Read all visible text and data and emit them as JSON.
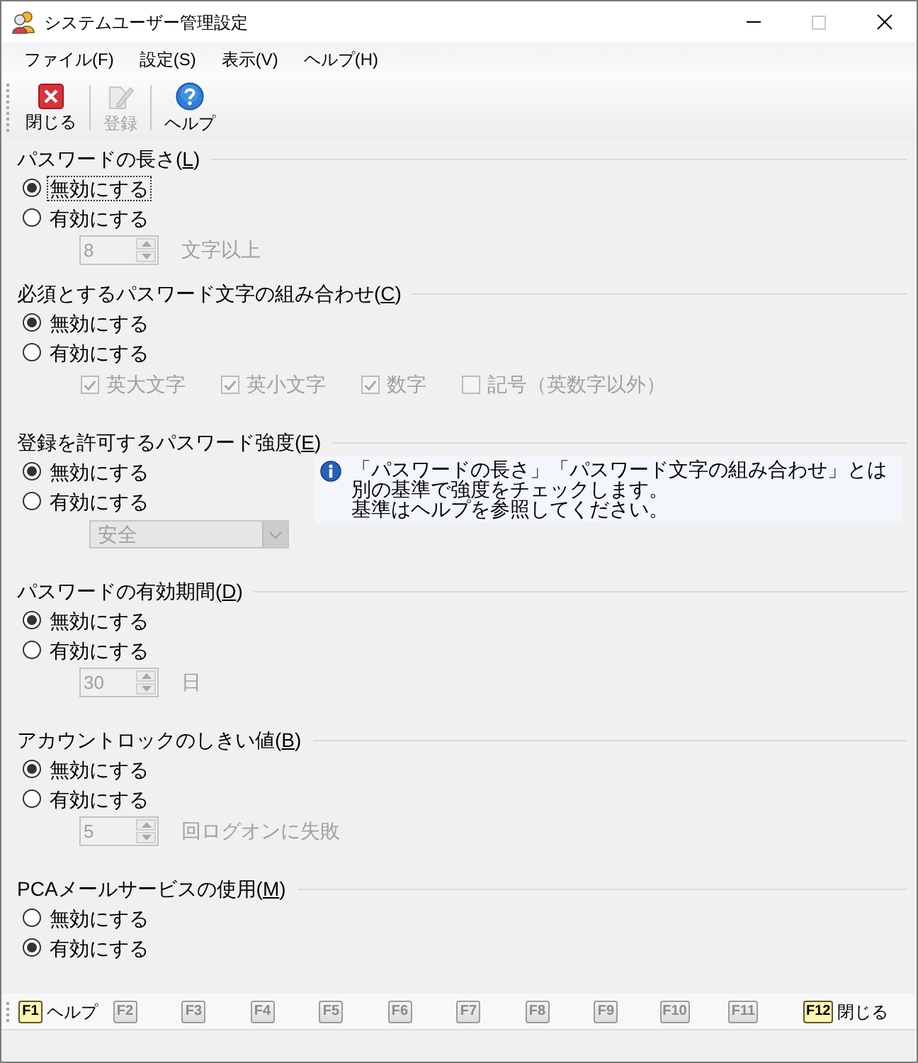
{
  "window": {
    "title": "システムユーザー管理設定"
  },
  "menu": [
    "ファイル(F)",
    "設定(S)",
    "表示(V)",
    "ヘルプ(H)"
  ],
  "toolbar": [
    {
      "kind": "close",
      "label": "閉じる",
      "disabled": false
    },
    {
      "kind": "register",
      "label": "登録",
      "disabled": true
    },
    {
      "kind": "help",
      "label": "ヘルプ",
      "disabled": false
    }
  ],
  "sections": [
    {
      "title": {
        "text": "パスワードの長さ(",
        "key": "L",
        "end": ")"
      },
      "options": [
        {
          "label": "無効にする",
          "selected": true,
          "focused": true
        },
        {
          "label": "有効にする",
          "selected": false,
          "focused": false
        }
      ],
      "detail": {
        "kind": "spinner",
        "value": "8",
        "unit": "文字以上",
        "disabled": true
      }
    },
    {
      "title": {
        "text": "必須とするパスワード文字の組み合わせ(",
        "key": "C",
        "end": ")"
      },
      "options": [
        {
          "label": "無効にする",
          "selected": true,
          "focused": false
        },
        {
          "label": "有効にする",
          "selected": false,
          "focused": false
        }
      ],
      "detail": {
        "kind": "checkboxes",
        "items": [
          {
            "label": "英大文字",
            "checked": true,
            "disabled": true
          },
          {
            "label": "英小文字",
            "checked": true,
            "disabled": true
          },
          {
            "label": "数字",
            "checked": true,
            "disabled": true
          },
          {
            "label": "記号（英数字以外）",
            "checked": false,
            "disabled": true
          }
        ]
      }
    },
    {
      "title": {
        "text": "登録を許可するパスワード強度(",
        "key": "E",
        "end": ")"
      },
      "options": [
        {
          "label": "無効にする",
          "selected": true,
          "focused": false
        },
        {
          "label": "有効にする",
          "selected": false,
          "focused": false
        }
      ],
      "detail": {
        "kind": "dropdown",
        "value": "安全",
        "disabled": true
      },
      "note": {
        "paragraphs": [
          "「パスワードの長さ」「パスワード文字の組み合わせ」とは別の基準で強度をチェックします。",
          "基準はヘルプを参照してください。"
        ]
      }
    },
    {
      "title": {
        "text": "パスワードの有効期間(",
        "key": "D",
        "end": ")"
      },
      "options": [
        {
          "label": "無効にする",
          "selected": true,
          "focused": false
        },
        {
          "label": "有効にする",
          "selected": false,
          "focused": false
        }
      ],
      "detail": {
        "kind": "spinner",
        "value": "30",
        "unit": "日",
        "disabled": true
      }
    },
    {
      "title": {
        "text": "アカウントロックのしきい値(",
        "key": "B",
        "end": ")"
      },
      "options": [
        {
          "label": "無効にする",
          "selected": true,
          "focused": false
        },
        {
          "label": "有効にする",
          "selected": false,
          "focused": false
        }
      ],
      "detail": {
        "kind": "spinner",
        "value": "5",
        "unit": "回ログオンに失敗",
        "disabled": true
      }
    },
    {
      "title": {
        "text": "PCAメールサービスの使用(",
        "key": "M",
        "end": ")"
      },
      "options": [
        {
          "label": "無効にする",
          "selected": false,
          "focused": false
        },
        {
          "label": "有効にする",
          "selected": true,
          "focused": false
        }
      ]
    }
  ],
  "function_keys": [
    {
      "key": "F1",
      "label": "ヘルプ",
      "enabled": true
    },
    {
      "key": "F2",
      "enabled": false
    },
    {
      "key": "F3",
      "enabled": false
    },
    {
      "key": "F4",
      "enabled": false
    },
    {
      "key": "F5",
      "enabled": false
    },
    {
      "key": "F6",
      "enabled": false
    },
    {
      "key": "F7",
      "enabled": false
    },
    {
      "key": "F8",
      "enabled": false
    },
    {
      "key": "F9",
      "enabled": false
    },
    {
      "key": "F10",
      "enabled": false
    },
    {
      "key": "F11",
      "enabled": false
    },
    {
      "key": "F12",
      "label": "閉じる",
      "enabled": true
    }
  ]
}
